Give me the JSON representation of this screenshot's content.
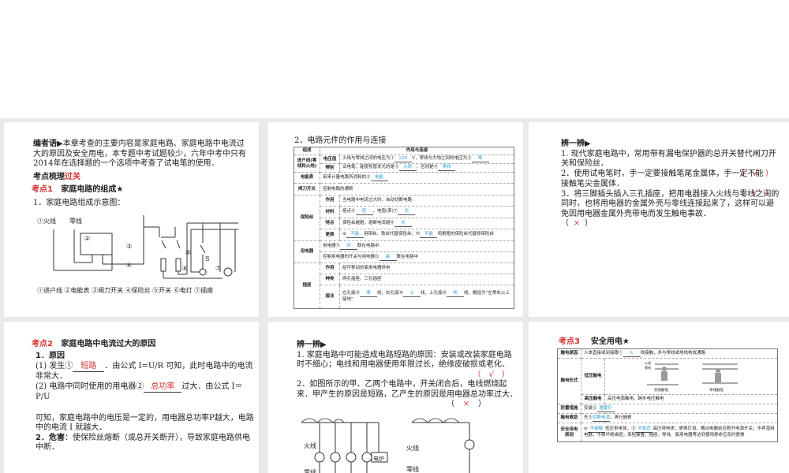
{
  "slide1": {
    "intro_label": "编者语▶",
    "intro_text": "本章考查的主要内容是家庭电路、家庭电路中电流过大的原因及安全用电，本专题中考试题较少，六年中考中只有2014年在选择题的一个选项中考查了试电笔的使用．",
    "section_a": "考点梳理",
    "section_b": "过关",
    "kp_label": "考点1",
    "kp_title": "家庭电路的组成★",
    "item1": "1．家庭电路组成示意图：",
    "live": "①火线",
    "neutral": "零线",
    "n2": "②",
    "n3": "③",
    "n4": "④",
    "n5": "⑤",
    "s": "S",
    "n6": "⑥",
    "n7": "⑦",
    "legend": "①进户线 ②电能表 ③闸刀开关 ④保险丝 ⑤开关 ⑥电灯 ⑦插座"
  },
  "slide2": {
    "title": "2．电路元件的作用与连接",
    "h1": "组成",
    "h2": "作用与连接",
    "r1": "进户线(零线和火线)",
    "r1a": "电压值",
    "r1a_t1": "火线与零线之间的电压为①",
    "r1a_f1": "220",
    "r1a_t2": "V，零线与大地之间的电压为②",
    "r1a_f2": "零",
    "r1b": "辨别",
    "r1b_t1": "试电笔，能使氖管发光的是③",
    "r1b_f1": "火线",
    "r1b_t2": "，否则是④",
    "r1b_f2": "零线",
    "r2": "电能表",
    "r2_t": "用来计量电路所消耗的⑤",
    "r2_f": "电能",
    "r3": "闸刀开关",
    "r3_t": "控制电路的通断",
    "r4": "保险丝",
    "r4a": "作用",
    "r4a_t": "当电路中电流过大时，自动切断电路",
    "r4b": "材料",
    "r4b_t1": "熔点⑥",
    "r4b_f1": "低",
    "r4b_t2": "，电阻(率)⑦",
    "r4b_f2": "大",
    "r4c": "特点",
    "r4c_t": "保险丝越粗，熔断电流越⑧",
    "r4c_f": "大",
    "r4d": "更换",
    "r4d_f1": "不能",
    "r4d_t1": "⑨",
    "r4d_t2": "用铜丝、铁丝代替保险丝；⑩",
    "r4d_f2": "不能",
    "r4d_t3": "用更粗的保险丝代替原保险丝",
    "r5": "用电器",
    "r5a_t1": "用电器⑪",
    "r5a_f": "并",
    "r5a_t2": "联在电路中",
    "r5b_t1": "控制用电器的开关与用电器⑫",
    "r5b_f": "串",
    "r5b_t2": "联在电路中",
    "r6": "插座",
    "r6a": "作用",
    "r6a_t": "给可移动的家用电器供电",
    "r6b": "种类",
    "r6b_t": "两孔插座、三孔插座",
    "r6c": "接法",
    "r6c_t1": "左孔接⑬",
    "r6c_f1": "零",
    "r6c_t2": "线，右孔接⑭",
    "r6c_f2": "火",
    "r6c_t3": "线，上孔接⑮",
    "r6c_f3": "地",
    "r6c_t4": "线，概括为“左零右火上接地”"
  },
  "slide3": {
    "heading": "辨一辨▶",
    "q1": "1. 现代家庭电路中，常用带有漏电保护器的总开关替代闸刀开关和保险丝．",
    "a1": "（　√　）",
    "q2": "2．使用试电笔时，手一定要接触笔尾金属体，手一定不能接触笔尖金属体．",
    "a2": "（　√　）",
    "q3": "3．将三脚插头插入三孔插座，把用电器接入火线与零线之间的同时，也将用电器的金属外壳与零线连接起来了，这样可以避免因用电器金属外壳带电而发生触电事故．",
    "a3_open": "（",
    "a3_mark": "×",
    "a3_close": "）"
  },
  "slide4": {
    "kp_label": "考点2",
    "kp_title": "家庭电路中电流过大的原因",
    "h1": "1．原因",
    "p1a": "(1) 发生①",
    "p1f": "短路",
    "p1b": "．由公式 I=U/R 可知，此时电路中的电流非常大．",
    "p2a": "(2) 电路中同时使用的用电器②",
    "p2f": "总功率",
    "p2b": "过大．由公式 I＝P/U",
    "p3": "可知，家庭电路中的电压是一定的，用电器总功率P越大，电路中的电流 I 就越大．",
    "h2": "2．危害",
    "p4": "：使保险丝熔断（或总开关断开），导致家庭电路供电中断．"
  },
  "slide5": {
    "heading": "辨一辨▶",
    "q1": "1. 家庭电路中可能造成电路短路的原因：安装或改装家庭电路时不细心；电线和用电器使用年限过长，绝缘皮破损或老化．",
    "a1": "（　√　）",
    "q2": "2．如图所示的甲、乙两个电路中，开关闭合后，电线燃烧起来．甲产生的原因是短路，乙产生的原因是用电器总功率过大．",
    "a2_open": "（",
    "a2_mark": "×",
    "a2_close": "）",
    "live": "火线",
    "neutral": "零线",
    "stove": "电炉"
  },
  "slide6": {
    "kp_label": "考点3",
    "kp_title": "安全用电★",
    "r1": "触电原因",
    "r1_t1": "人体直接或间接跟①",
    "r1_f": "火",
    "r1_t2": "线接触，并与零线或地线构成通路",
    "r2": "触电形式",
    "r2a": "低压触电",
    "fig_live": "火线",
    "fig_neutral": "零线",
    "fig1": "双线触电",
    "fig2": "单线触电",
    "r2b": "高压触电",
    "r2b_t": "高压电弧触电、跨步电压触电",
    "r3": "防雷措施",
    "r3_t": "安装②",
    "r3_f": "避雷针",
    "r4": "触电救助",
    "r4_t1": "先③",
    "r4_f": "切断电源",
    "r4_t2": "，再行施救",
    "r5": "安全用电原则",
    "r5_t1": "④",
    "r5_f1": "不接触",
    "r5_t2": "低压带电体，⑤",
    "r5_f2": "不靠近",
    "r5_t3": "高压带电体；更换灯泡、搬动电器前应断开电源开关；不弄湿用电器，不损坏绝缘层；保险装置、插座、导线、家用电器等达到使用寿命应及时更换"
  }
}
